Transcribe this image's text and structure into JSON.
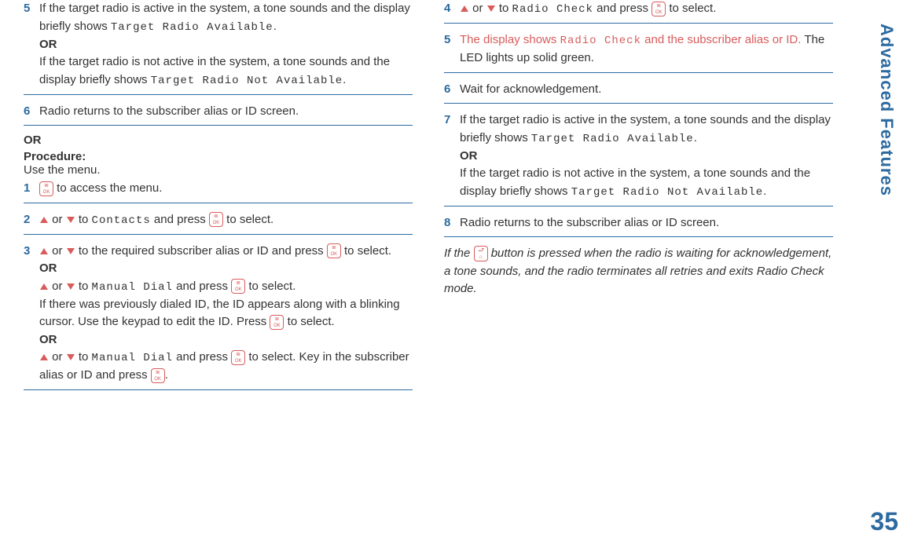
{
  "left": {
    "s5a": "If the target radio is active in the system, a tone sounds and the display briefly shows ",
    "s5a_mono": "Target Radio Available",
    "s5or": "OR",
    "s5b": "If the target radio is not active in the system, a tone sounds and the display briefly shows ",
    "s5b_mono": "Target Radio Not Available",
    "s6": "Radio returns to the subscriber alias or ID screen.",
    "orBlock": "OR",
    "procH": "Procedure:",
    "procT": "Use the menu.",
    "s1": " to access the menu.",
    "s2a": " or ",
    "s2b": " to ",
    "s2_mono": "Contacts",
    "s2c": " and press ",
    "s2d": " to select.",
    "s3a": " or ",
    "s3b": " to the required subscriber alias or ID and press ",
    "s3c": " to select.",
    "s3or1": "OR",
    "s3d": " or ",
    "s3e": " to ",
    "s3_mono": "Manual Dial",
    "s3f": " and press ",
    "s3g": " to select.",
    "s3h": "If there was previously dialed ID, the ID appears along with a blinking cursor. Use the keypad to edit the ID. Press ",
    "s3i": " to select.",
    "s3or2": "OR",
    "s3j": " or ",
    "s3k": " to ",
    "s3_mono2": "Manual Dial",
    "s3l": " and press ",
    "s3m": " to select. Key in the subscriber alias or ID and press ",
    "s3n": "."
  },
  "right": {
    "s4a": " or ",
    "s4b": " to ",
    "s4_mono": "Radio Check",
    "s4c": " and press ",
    "s4d": " to select.",
    "s5a": " The display shows ",
    "s5_mono": "Radio Check",
    "s5b": " and the subscriber alias or ID.",
    "s5c": " The LED lights up solid green.",
    "s6": "Wait for acknowledgement.",
    "s7a": "If the target radio is active in the system, a tone sounds and the display briefly shows ",
    "s7a_mono": "Target Radio Available",
    "s7or": "OR",
    "s7b": "If the target radio is not active in the system, a tone sounds and the display briefly shows ",
    "s7b_mono": "Target Radio Not Available",
    "s8": "Radio returns to the subscriber alias or ID screen.",
    "note1": "If the ",
    "note2": " button is pressed when the radio is waiting for acknowledgement, a tone sounds, and the radio terminates all retries and exits Radio Check mode."
  },
  "sidebar": "Advanced Features",
  "pagenum": "35",
  "period": "."
}
